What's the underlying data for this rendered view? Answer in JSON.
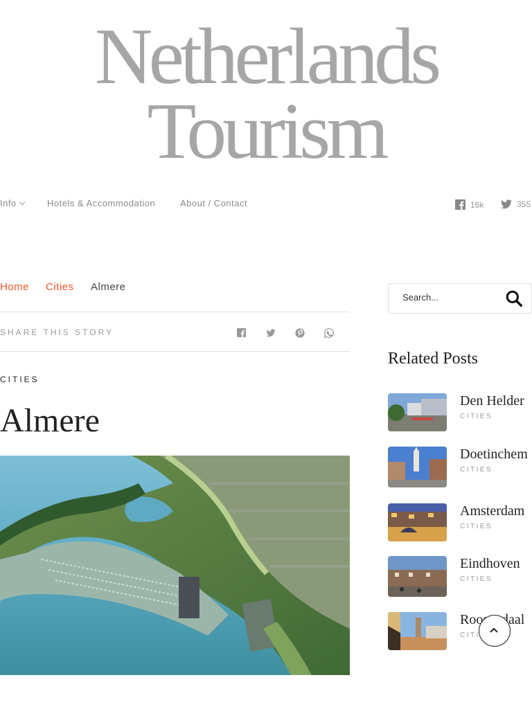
{
  "site": {
    "title_line1": "Netherlands",
    "title_line2": "Tourism"
  },
  "nav": {
    "items": [
      {
        "label": "Info"
      },
      {
        "label": "Hotels & Accommodation"
      },
      {
        "label": "About / Contact"
      }
    ]
  },
  "social": {
    "facebook_count": "16k",
    "twitter_count": "355"
  },
  "breadcrumb": {
    "home": "Home",
    "cities": "Cities",
    "current": "Almere"
  },
  "share": {
    "label": "SHARE THIS STORY",
    "icons": [
      "facebook-icon",
      "twitter-icon",
      "pinterest-icon",
      "whatsapp-icon"
    ]
  },
  "article": {
    "category": "CITIES",
    "title": "Almere"
  },
  "sidebar": {
    "search": {
      "placeholder": "Search..."
    },
    "related_title": "Related Posts",
    "posts": [
      {
        "name": "Den Helder",
        "category": "CITIES"
      },
      {
        "name": "Doetinchem",
        "category": "CITIES"
      },
      {
        "name": "Amsterdam",
        "category": "CITIES"
      },
      {
        "name": "Eindhoven",
        "category": "CITIES"
      },
      {
        "name": "Roosendaal",
        "category": "CITIES"
      }
    ]
  },
  "colors": {
    "accent": "#e8562a",
    "logo": "#a6a6a6"
  }
}
